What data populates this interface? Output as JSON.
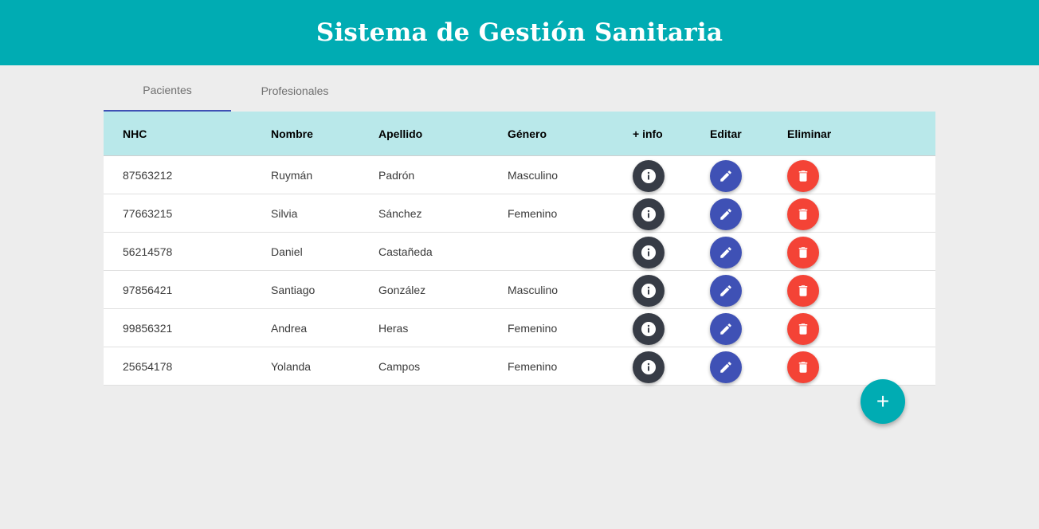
{
  "header": {
    "title": "Sistema de Gestión Sanitaria"
  },
  "tabs": [
    {
      "label": "Pacientes",
      "active": true
    },
    {
      "label": "Profesionales",
      "active": false
    }
  ],
  "table": {
    "columns": [
      "NHC",
      "Nombre",
      "Apellido",
      "Género",
      "+ info",
      "Editar",
      "Eliminar"
    ],
    "rows": [
      {
        "nhc": "87563212",
        "nombre": "Ruymán",
        "apellido": "Padrón",
        "genero": "Masculino"
      },
      {
        "nhc": "77663215",
        "nombre": "Silvia",
        "apellido": "Sánchez",
        "genero": "Femenino"
      },
      {
        "nhc": "56214578",
        "nombre": "Daniel",
        "apellido": "Castañeda",
        "genero": ""
      },
      {
        "nhc": "97856421",
        "nombre": "Santiago",
        "apellido": "González",
        "genero": "Masculino"
      },
      {
        "nhc": "99856321",
        "nombre": "Andrea",
        "apellido": "Heras",
        "genero": "Femenino"
      },
      {
        "nhc": "25654178",
        "nombre": "Yolanda",
        "apellido": "Campos",
        "genero": "Femenino"
      }
    ]
  },
  "add_button": {
    "symbol": "+",
    "icon": "plus-icon"
  },
  "icons": {
    "info": "info-icon",
    "edit": "pencil-icon",
    "delete": "trash-icon"
  },
  "colors": {
    "primary": "#00acb3",
    "header_row": "#b9e8ea",
    "tab_indicator": "#3f51b5",
    "info_button": "#373c46",
    "edit_button": "#3f51b5",
    "delete_button": "#f44336"
  }
}
